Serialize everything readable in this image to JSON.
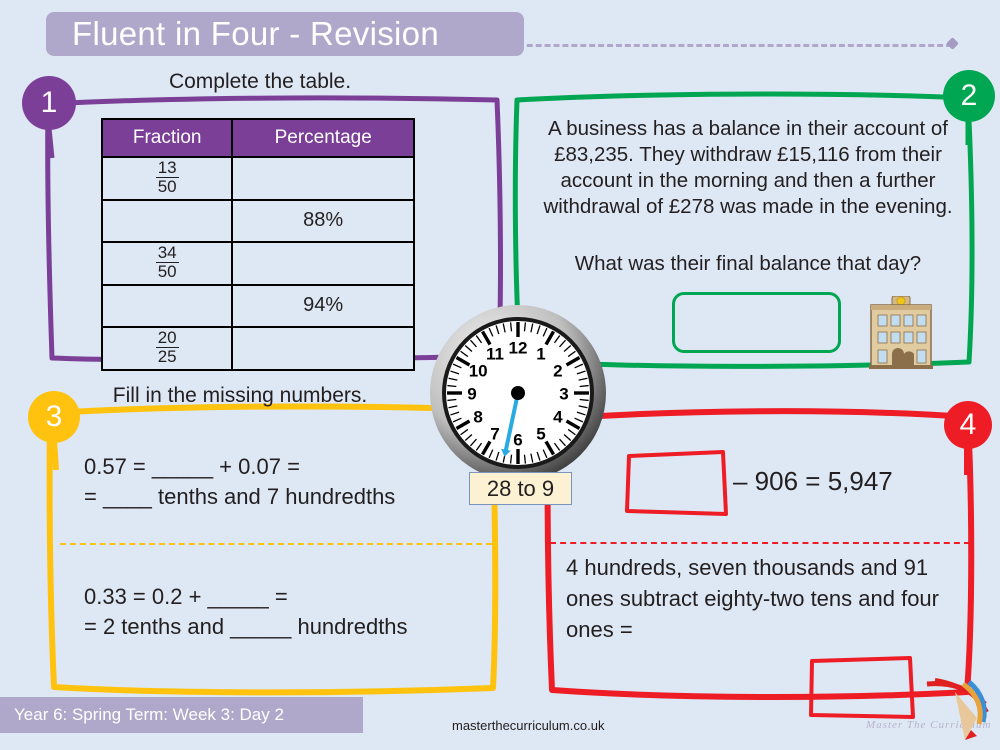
{
  "header": {
    "title": "Fluent in Four - Revision",
    "banner_color": "#b0a8ca"
  },
  "questions": [
    {
      "number": "1",
      "color": "#7b3f98",
      "instruction": "Complete the table.",
      "table": {
        "headers": [
          "Fraction",
          "Percentage"
        ],
        "rows": [
          {
            "fraction_num": "13",
            "fraction_den": "50",
            "percentage": ""
          },
          {
            "fraction_num": "",
            "fraction_den": "",
            "percentage": "88%"
          },
          {
            "fraction_num": "34",
            "fraction_den": "50",
            "percentage": ""
          },
          {
            "fraction_num": "",
            "fraction_den": "",
            "percentage": "94%"
          },
          {
            "fraction_num": "20",
            "fraction_den": "25",
            "percentage": ""
          }
        ]
      }
    },
    {
      "number": "2",
      "color": "#00a651",
      "body": "A business has a balance in their account of £83,235. They withdraw £15,116 from their account in the morning and then a further withdrawal of £278 was made in the evening.",
      "question": "What was their final balance that day?",
      "answer_box": "",
      "icon": "bank-building-icon"
    },
    {
      "number": "3",
      "color": "#ffc20e",
      "instruction": "Fill in the missing numbers.",
      "part_a_line1": "0.57 = _____ + 0.07 =",
      "part_a_line2": "= ____ tenths and 7 hundredths",
      "part_b_line1": "0.33 = 0.2 +  _____  =",
      "part_b_line2": "=  2 tenths and _____ hundredths"
    },
    {
      "number": "4",
      "color": "#ee1c25",
      "part_a_equation": "– 906 = 5,947",
      "part_b_text": "4 hundreds, seven thousands and 91 ones subtract eighty-two tens and four ones = ",
      "answer_box": ""
    }
  ],
  "clock": {
    "label": "28 to 9",
    "minute_hand_minutes": 32,
    "numerals": [
      "12",
      "1",
      "2",
      "3",
      "4",
      "5",
      "6",
      "7",
      "8",
      "9",
      "10",
      "11"
    ],
    "hand_color": "#29abe2"
  },
  "footer": {
    "term_label": "Year 6: Spring Term: Week 3: Day  2",
    "url": "masterthecurriculum.co.uk",
    "logo_text": "Master  The  Curriculum"
  }
}
